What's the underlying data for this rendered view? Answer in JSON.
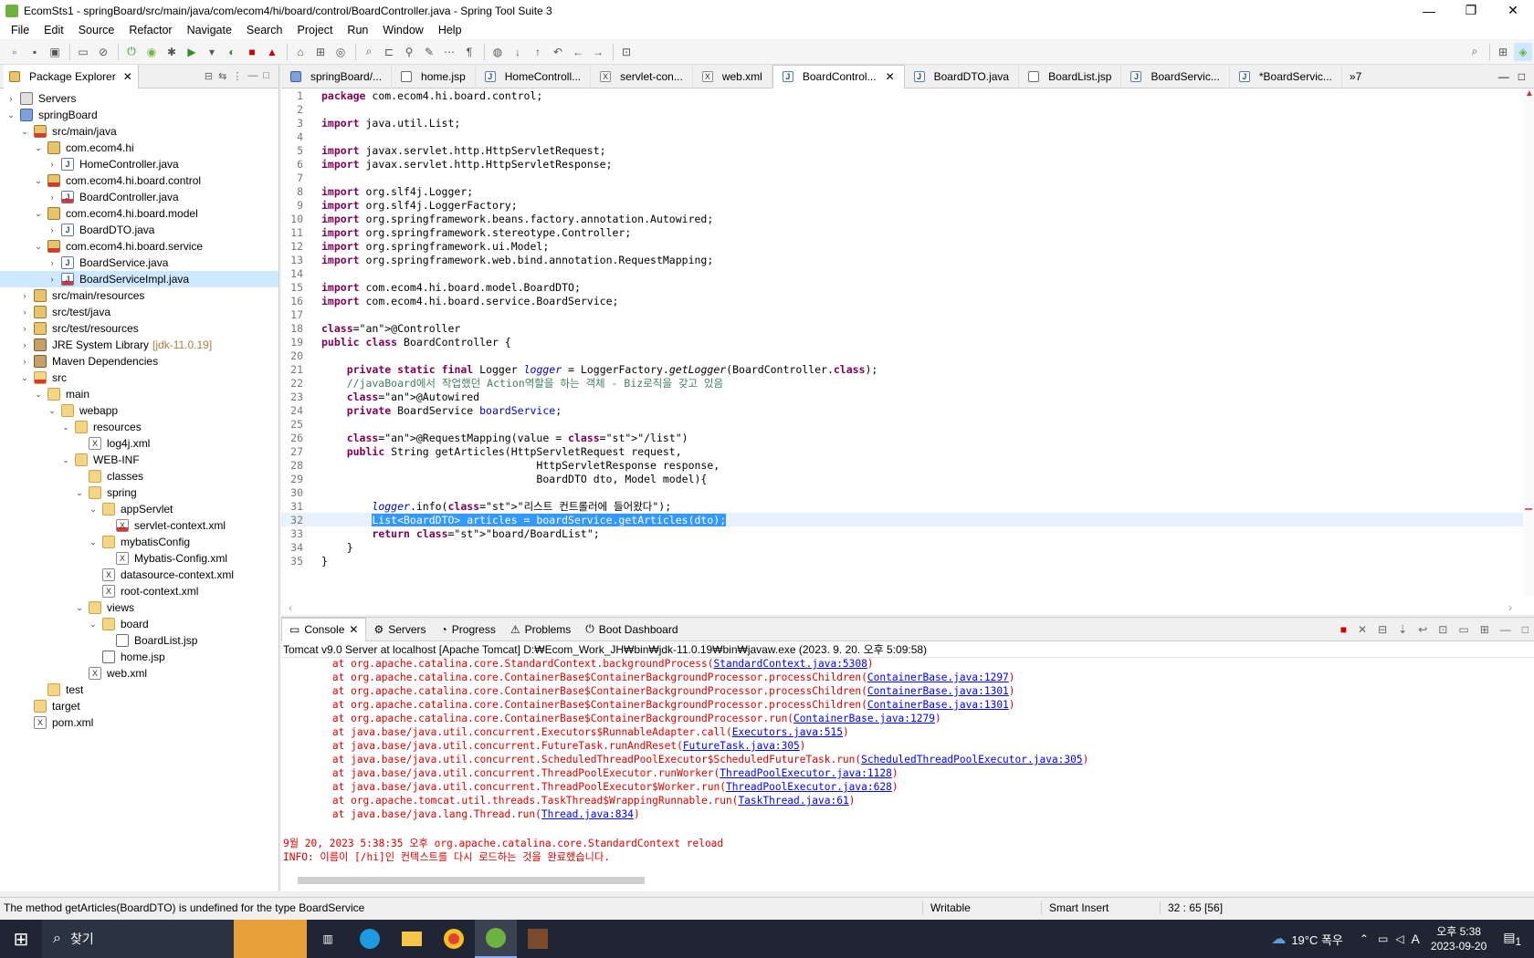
{
  "window": {
    "title": "EcomSts1 - springBoard/src/main/java/com/ecom4/hi/board/control/BoardController.java - Spring Tool Suite 3",
    "minimize": "—",
    "maximize": "❐",
    "close": "✕"
  },
  "menu": [
    "File",
    "Edit",
    "Source",
    "Refactor",
    "Navigate",
    "Search",
    "Project",
    "Run",
    "Window",
    "Help"
  ],
  "package_explorer": {
    "tab_label": "Package Explorer",
    "tree": [
      {
        "label": "Servers",
        "depth": 0,
        "twisty": "›",
        "icon": "server"
      },
      {
        "label": "springBoard",
        "depth": 0,
        "twisty": "⌄",
        "icon": "proj"
      },
      {
        "label": "src/main/java",
        "depth": 1,
        "twisty": "⌄",
        "icon": "pkg",
        "err": true
      },
      {
        "label": "com.ecom4.hi",
        "depth": 2,
        "twisty": "⌄",
        "icon": "pkg"
      },
      {
        "label": "HomeController.java",
        "depth": 3,
        "twisty": "›",
        "icon": "java"
      },
      {
        "label": "com.ecom4.hi.board.control",
        "depth": 2,
        "twisty": "⌄",
        "icon": "pkg",
        "err": true
      },
      {
        "label": "BoardController.java",
        "depth": 3,
        "twisty": "›",
        "icon": "java",
        "err": true
      },
      {
        "label": "com.ecom4.hi.board.model",
        "depth": 2,
        "twisty": "⌄",
        "icon": "pkg"
      },
      {
        "label": "BoardDTO.java",
        "depth": 3,
        "twisty": "›",
        "icon": "java"
      },
      {
        "label": "com.ecom4.hi.board.service",
        "depth": 2,
        "twisty": "⌄",
        "icon": "pkg",
        "err": true
      },
      {
        "label": "BoardService.java",
        "depth": 3,
        "twisty": "›",
        "icon": "java"
      },
      {
        "label": "BoardServiceImpl.java",
        "depth": 3,
        "twisty": "›",
        "icon": "java",
        "err": true,
        "selected": true
      },
      {
        "label": "src/main/resources",
        "depth": 1,
        "twisty": "›",
        "icon": "pkg"
      },
      {
        "label": "src/test/java",
        "depth": 1,
        "twisty": "›",
        "icon": "pkg"
      },
      {
        "label": "src/test/resources",
        "depth": 1,
        "twisty": "›",
        "icon": "pkg"
      },
      {
        "label": "JRE System Library",
        "suffix": "[jdk-11.0.19]",
        "depth": 1,
        "twisty": "›",
        "icon": "lib"
      },
      {
        "label": "Maven Dependencies",
        "depth": 1,
        "twisty": "›",
        "icon": "lib"
      },
      {
        "label": "src",
        "depth": 1,
        "twisty": "⌄",
        "icon": "folder",
        "err": true
      },
      {
        "label": "main",
        "depth": 2,
        "twisty": "⌄",
        "icon": "folder"
      },
      {
        "label": "webapp",
        "depth": 3,
        "twisty": "⌄",
        "icon": "folder"
      },
      {
        "label": "resources",
        "depth": 4,
        "twisty": "⌄",
        "icon": "folder"
      },
      {
        "label": "log4j.xml",
        "depth": 5,
        "twisty": "",
        "icon": "xml"
      },
      {
        "label": "WEB-INF",
        "depth": 4,
        "twisty": "⌄",
        "icon": "folder"
      },
      {
        "label": "classes",
        "depth": 5,
        "twisty": "",
        "icon": "folder"
      },
      {
        "label": "spring",
        "depth": 5,
        "twisty": "⌄",
        "icon": "folder"
      },
      {
        "label": "appServlet",
        "depth": 6,
        "twisty": "⌄",
        "icon": "folder"
      },
      {
        "label": "servlet-context.xml",
        "depth": 7,
        "twisty": "",
        "icon": "xml",
        "err": true
      },
      {
        "label": "mybatisConfig",
        "depth": 6,
        "twisty": "⌄",
        "icon": "folder"
      },
      {
        "label": "Mybatis-Config.xml",
        "depth": 7,
        "twisty": "",
        "icon": "xml"
      },
      {
        "label": "datasource-context.xml",
        "depth": 6,
        "twisty": "",
        "icon": "xml"
      },
      {
        "label": "root-context.xml",
        "depth": 6,
        "twisty": "",
        "icon": "xml"
      },
      {
        "label": "views",
        "depth": 5,
        "twisty": "⌄",
        "icon": "folder"
      },
      {
        "label": "board",
        "depth": 6,
        "twisty": "⌄",
        "icon": "folder"
      },
      {
        "label": "BoardList.jsp",
        "depth": 7,
        "twisty": "",
        "icon": "jsp"
      },
      {
        "label": "home.jsp",
        "depth": 6,
        "twisty": "",
        "icon": "jsp"
      },
      {
        "label": "web.xml",
        "depth": 5,
        "twisty": "",
        "icon": "xml"
      },
      {
        "label": "test",
        "depth": 2,
        "twisty": "",
        "icon": "folder"
      },
      {
        "label": "target",
        "depth": 1,
        "twisty": "",
        "icon": "folder"
      },
      {
        "label": "pom.xml",
        "depth": 1,
        "twisty": "",
        "icon": "xml"
      }
    ]
  },
  "editor_tabs": [
    {
      "label": "springBoard/...",
      "icon": "proj"
    },
    {
      "label": "home.jsp",
      "icon": "jsp"
    },
    {
      "label": "HomeControll...",
      "icon": "java"
    },
    {
      "label": "servlet-con...",
      "icon": "xml"
    },
    {
      "label": "web.xml",
      "icon": "xml"
    },
    {
      "label": "BoardControl...",
      "icon": "java",
      "active": true
    },
    {
      "label": "BoardDTO.java",
      "icon": "java"
    },
    {
      "label": "BoardList.jsp",
      "icon": "jsp"
    },
    {
      "label": "BoardServic...",
      "icon": "java"
    },
    {
      "label": "*BoardServic...",
      "icon": "java"
    }
  ],
  "editor_overflow": "»7",
  "code_lines": [
    "package com.ecom4.hi.board.control;",
    "",
    "import java.util.List;",
    "",
    "import javax.servlet.http.HttpServletRequest;",
    "import javax.servlet.http.HttpServletResponse;",
    "",
    "import org.slf4j.Logger;",
    "import org.slf4j.LoggerFactory;",
    "import org.springframework.beans.factory.annotation.Autowired;",
    "import org.springframework.stereotype.Controller;",
    "import org.springframework.ui.Model;",
    "import org.springframework.web.bind.annotation.RequestMapping;",
    "",
    "import com.ecom4.hi.board.model.BoardDTO;",
    "import com.ecom4.hi.board.service.BoardService;",
    "",
    "@Controller",
    "public class BoardController {",
    "",
    "    private static final Logger logger = LoggerFactory.getLogger(BoardController.class);",
    "    //javaBoard에서 작업했던 Action역할을 하는 객체 - Biz로직을 갖고 있음",
    "    @Autowired",
    "    private BoardService boardService;",
    "",
    "    @RequestMapping(value = \"/list\")",
    "    public String getArticles(HttpServletRequest request,",
    "                                  HttpServletResponse response,",
    "                                  BoardDTO dto, Model model){",
    "",
    "        logger.info(\"리스트 컨트롤러에 들어왔다\");",
    "        List<BoardDTO> articles = boardService.getArticles(dto);",
    "        return \"board/BoardList\";",
    "    }",
    "}"
  ],
  "bottom_tabs": [
    {
      "label": "Console",
      "active": true
    },
    {
      "label": "Servers"
    },
    {
      "label": "Progress"
    },
    {
      "label": "Problems"
    },
    {
      "label": "Boot Dashboard"
    }
  ],
  "console": {
    "header": "Tomcat v9.0 Server at localhost [Apache Tomcat] D:₩Ecom_Work_JH₩bin₩jdk-11.0.19₩bin₩javaw.exe  (2023. 9. 20. 오후 5:09:58)",
    "lines": [
      {
        "pre": "        at org.apache.catalina.core.StandardContext.backgroundProcess(",
        "link": "StandardContext.java:5308",
        "post": ")"
      },
      {
        "pre": "        at org.apache.catalina.core.ContainerBase$ContainerBackgroundProcessor.processChildren(",
        "link": "ContainerBase.java:1297",
        "post": ")"
      },
      {
        "pre": "        at org.apache.catalina.core.ContainerBase$ContainerBackgroundProcessor.processChildren(",
        "link": "ContainerBase.java:1301",
        "post": ")"
      },
      {
        "pre": "        at org.apache.catalina.core.ContainerBase$ContainerBackgroundProcessor.processChildren(",
        "link": "ContainerBase.java:1301",
        "post": ")"
      },
      {
        "pre": "        at org.apache.catalina.core.ContainerBase$ContainerBackgroundProcessor.run(",
        "link": "ContainerBase.java:1279",
        "post": ")"
      },
      {
        "pre": "        at java.base/java.util.concurrent.Executors$RunnableAdapter.call(",
        "link": "Executors.java:515",
        "post": ")"
      },
      {
        "pre": "        at java.base/java.util.concurrent.FutureTask.runAndReset(",
        "link": "FutureTask.java:305",
        "post": ")"
      },
      {
        "pre": "        at java.base/java.util.concurrent.ScheduledThreadPoolExecutor$ScheduledFutureTask.run(",
        "link": "ScheduledThreadPoolExecutor.java:305",
        "post": ")"
      },
      {
        "pre": "        at java.base/java.util.concurrent.ThreadPoolExecutor.runWorker(",
        "link": "ThreadPoolExecutor.java:1128",
        "post": ")"
      },
      {
        "pre": "        at java.base/java.util.concurrent.ThreadPoolExecutor$Worker.run(",
        "link": "ThreadPoolExecutor.java:628",
        "post": ")"
      },
      {
        "pre": "        at org.apache.tomcat.util.threads.TaskThread$WrappingRunnable.run(",
        "link": "TaskThread.java:61",
        "post": ")"
      },
      {
        "pre": "        at java.base/java.lang.Thread.run(",
        "link": "Thread.java:834",
        "post": ")"
      },
      {
        "pre": "",
        "link": "",
        "post": ""
      },
      {
        "pre": "9월 20, 2023 5:38:35 오후 org.apache.catalina.core.StandardContext reload",
        "link": "",
        "post": ""
      },
      {
        "pre": "INFO: 이름이 [/hi]인 컨텍스트를 다시 로드하는 것을 완료했습니다.",
        "link": "",
        "post": ""
      }
    ]
  },
  "status": {
    "message": "The method getArticles(BoardDTO) is undefined for the type BoardService",
    "writable": "Writable",
    "insert_mode": "Smart Insert",
    "position": "32 : 65 [56]"
  },
  "taskbar": {
    "search": "찾기",
    "weather": "19°C 폭우",
    "time": "오후 5:38",
    "date": "2023-09-20",
    "ime": "A",
    "notifications": "1"
  },
  "colors": {
    "error": "#e00000",
    "link": "#0000ff",
    "selection": "#3399ff",
    "keyword": "#7f0055"
  }
}
